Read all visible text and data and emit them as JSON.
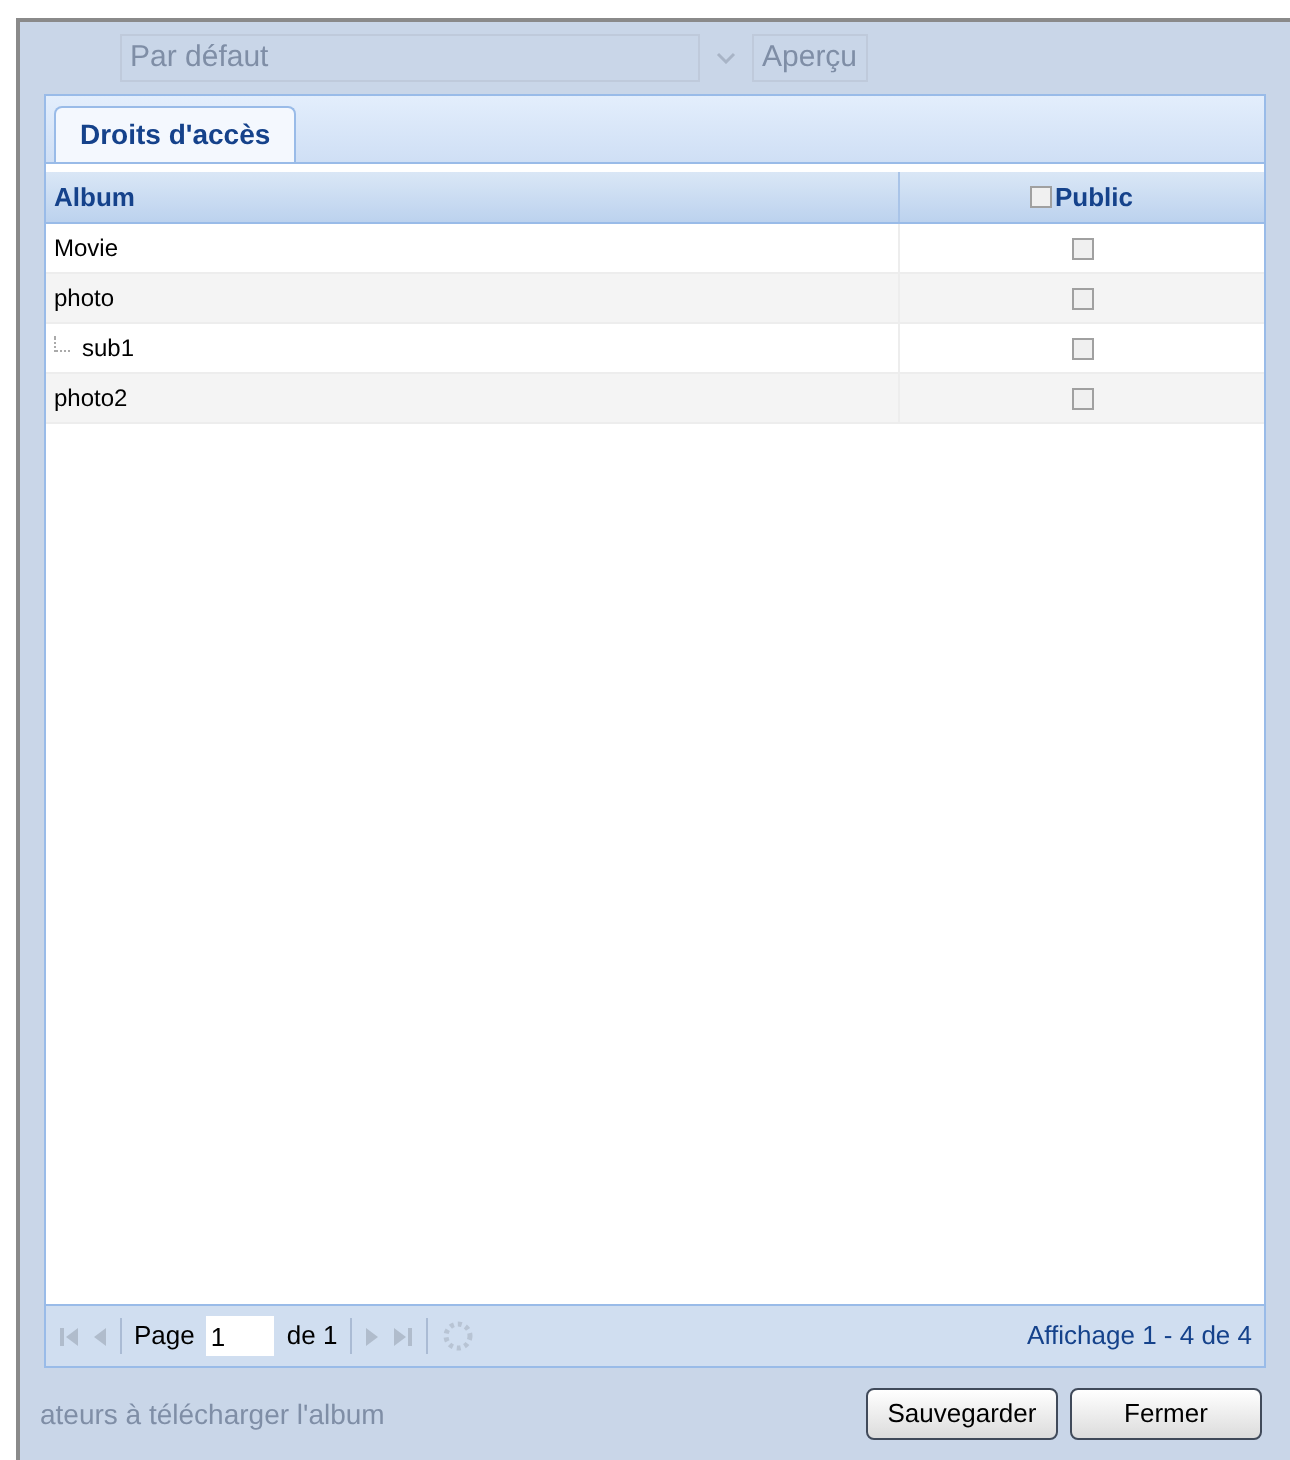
{
  "background": {
    "select_value": "Par défaut",
    "preview_button": "Aperçu",
    "text": "ateurs à télécharger l'album"
  },
  "tabs": [
    {
      "label": "Droits d'accès",
      "selected": true
    }
  ],
  "table": {
    "columns": [
      "Album",
      "Public"
    ],
    "header_checked": false,
    "rows": [
      {
        "name": "Movie",
        "public": false
      },
      {
        "name": "photo",
        "public": false,
        "children": [
          {
            "name": "sub1",
            "public": false
          }
        ]
      },
      {
        "name": "photo2",
        "public": false
      }
    ]
  },
  "paging": {
    "page_label": "Page",
    "page_value": "1",
    "of_label": "de 1",
    "summary": "Affichage 1 - 4 de 4"
  },
  "buttons": [
    "Sauvegarder",
    "Fermer"
  ]
}
